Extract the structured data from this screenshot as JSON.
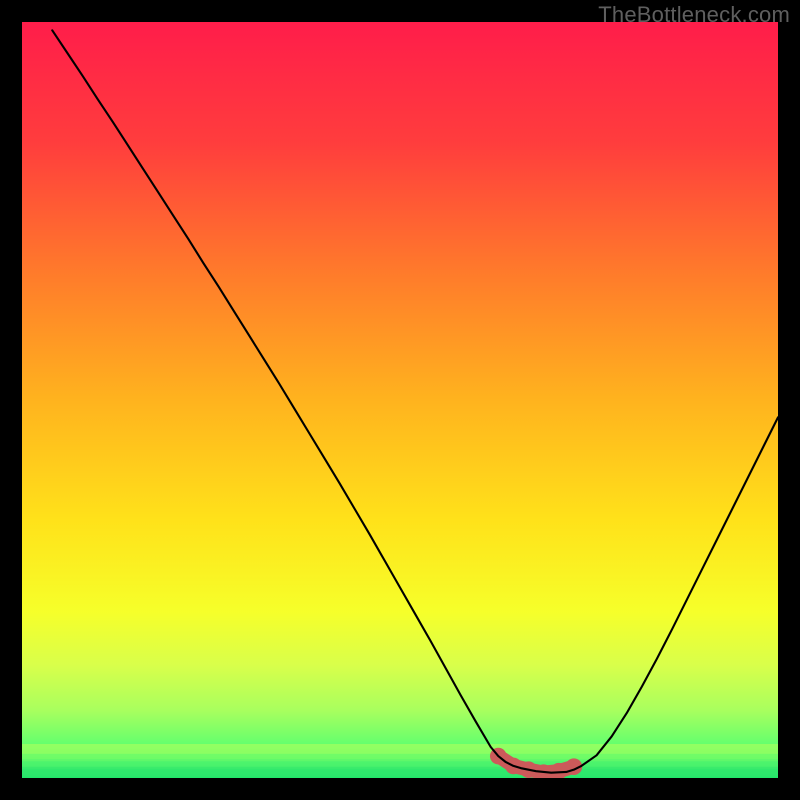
{
  "watermark": "TheBottleneck.com",
  "chart_data": {
    "type": "line",
    "title": "",
    "xlabel": "",
    "ylabel": "",
    "xlim": [
      0,
      100
    ],
    "ylim": [
      0,
      100
    ],
    "grid": false,
    "legend": false,
    "x": [
      4,
      6,
      8,
      10,
      12,
      14,
      16,
      18,
      20,
      22,
      24,
      26,
      28,
      30,
      32,
      34,
      36,
      38,
      40,
      42,
      44,
      46,
      48,
      50,
      52,
      54,
      56,
      58,
      60,
      62,
      63,
      64,
      65,
      66,
      68,
      70,
      72,
      73,
      74,
      76,
      78,
      80,
      82,
      84,
      86,
      88,
      90,
      92,
      94,
      96,
      98,
      100
    ],
    "values": [
      98.9,
      95.9,
      92.9,
      89.8,
      86.8,
      83.7,
      80.6,
      77.5,
      74.4,
      71.3,
      68.1,
      65.0,
      61.8,
      58.6,
      55.4,
      52.2,
      48.9,
      45.6,
      42.3,
      39.0,
      35.6,
      32.2,
      28.7,
      25.2,
      21.7,
      18.2,
      14.6,
      11.0,
      7.5,
      4.1,
      2.9,
      2.1,
      1.6,
      1.3,
      0.9,
      0.7,
      0.8,
      1.1,
      1.6,
      3.0,
      5.5,
      8.6,
      12.1,
      15.8,
      19.7,
      23.7,
      27.7,
      31.7,
      35.7,
      39.7,
      43.7,
      47.7
    ],
    "bottom_markers_x": [
      63,
      65,
      67,
      69,
      71,
      73
    ],
    "bottom_markers_y": [
      2.9,
      1.6,
      1.1,
      0.7,
      0.9,
      1.5
    ],
    "marker_color": "#cc5a5a",
    "marker_radius_pct": 1.1,
    "gradient_stops": [
      {
        "offset": 0.0,
        "color": "#ff1d4a"
      },
      {
        "offset": 0.16,
        "color": "#ff3d3d"
      },
      {
        "offset": 0.33,
        "color": "#ff7a2b"
      },
      {
        "offset": 0.5,
        "color": "#ffb31e"
      },
      {
        "offset": 0.66,
        "color": "#ffe21a"
      },
      {
        "offset": 0.78,
        "color": "#f6ff2a"
      },
      {
        "offset": 0.85,
        "color": "#d9ff4a"
      },
      {
        "offset": 0.91,
        "color": "#a9ff5e"
      },
      {
        "offset": 0.96,
        "color": "#5dff6f"
      },
      {
        "offset": 1.0,
        "color": "#22e66a"
      }
    ],
    "green_bands": [
      {
        "y_pct": 0.955,
        "color": "#baff5a"
      },
      {
        "y_pct": 0.965,
        "color": "#8cff62"
      },
      {
        "y_pct": 0.975,
        "color": "#56f46e"
      },
      {
        "y_pct": 0.985,
        "color": "#2fe56e"
      }
    ]
  }
}
